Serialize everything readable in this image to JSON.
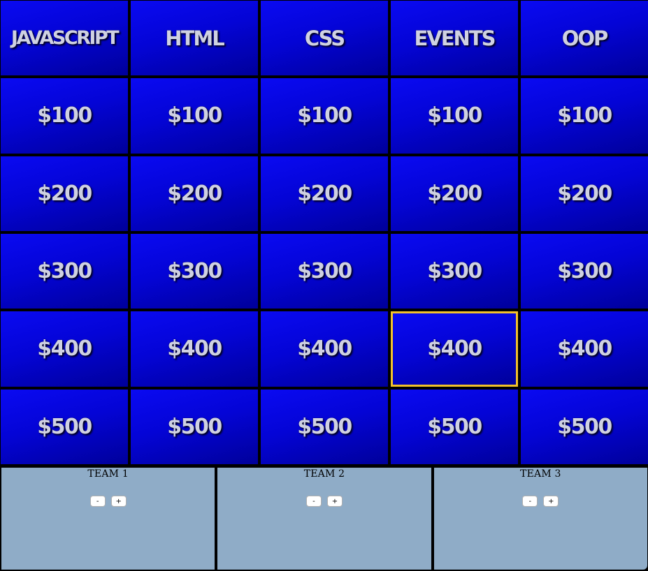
{
  "board": {
    "categories": [
      "JAVASCRIPT",
      "HTML",
      "CSS",
      "EVENTS",
      "OOP"
    ],
    "values": [
      "$100",
      "$200",
      "$300",
      "$400",
      "$500"
    ],
    "selected_cell": {
      "category_index": 3,
      "value_index": 3
    },
    "colors": {
      "tile_top": "#0a0af2",
      "tile_bottom": "#00009a",
      "tile_text": "#cfd1e2",
      "selected_border": "#f2c22b",
      "grid_lines": "#000000"
    }
  },
  "teams": [
    {
      "name": "TEAM 1",
      "minus_label": "-",
      "plus_label": "+"
    },
    {
      "name": "TEAM 2",
      "minus_label": "-",
      "plus_label": "+"
    },
    {
      "name": "TEAM 3",
      "minus_label": "-",
      "plus_label": "+"
    }
  ],
  "team_panel_color": "#8facc7"
}
